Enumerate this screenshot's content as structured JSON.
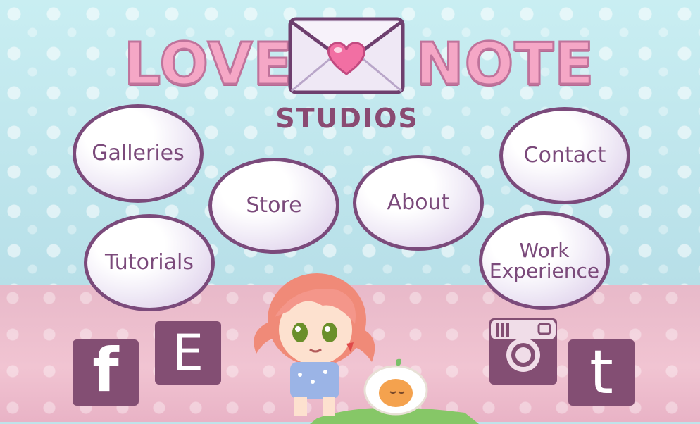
{
  "logo": {
    "word_left": "LOVE",
    "word_right": "NOTE",
    "subtitle": "STUDIOS"
  },
  "nav": {
    "galleries": "Galleries",
    "store": "Store",
    "about": "About",
    "contact": "Contact",
    "tutorials": "Tutorials",
    "work_line1": "Work",
    "work_line2": "Experience"
  },
  "social": {
    "facebook_glyph": "f",
    "etsy_glyph": "E",
    "tumblr_glyph": "t",
    "instagram_icon": "instagram-icon"
  },
  "colors": {
    "accent": "#7b4a7b",
    "social_tile": "#834e73",
    "logo_pink": "#f5a7c6"
  }
}
